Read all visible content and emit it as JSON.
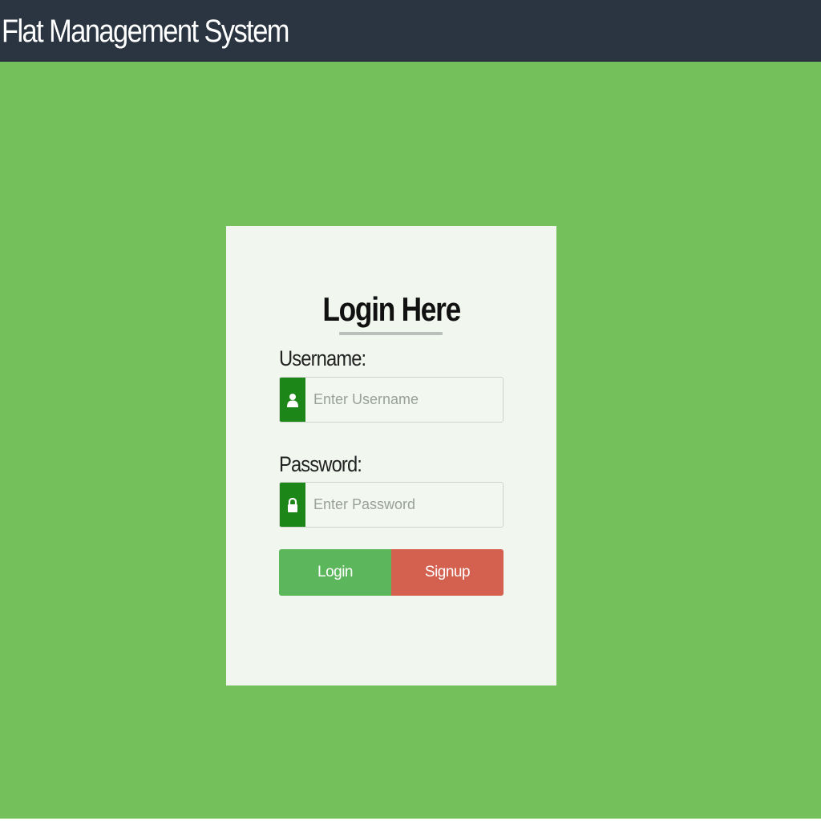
{
  "header": {
    "brand_title": "Flat Management System"
  },
  "login_form": {
    "title": "Login Here",
    "username": {
      "label": "Username:",
      "placeholder": "Enter Username",
      "value": "",
      "icon": "user-icon"
    },
    "password": {
      "label": "Password:",
      "placeholder": "Enter Password",
      "value": "",
      "icon": "lock-icon"
    },
    "buttons": {
      "login_label": "Login",
      "signup_label": "Signup"
    }
  },
  "colors": {
    "background": "#74c05b",
    "topbar": "#2b3542",
    "card": "#f1f7ee",
    "icon_addon": "#1d8618",
    "login_button": "#5cb75c",
    "signup_button": "#d46050"
  }
}
